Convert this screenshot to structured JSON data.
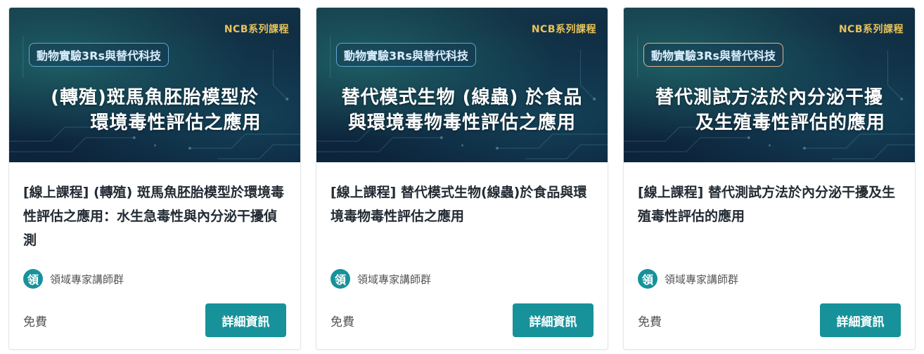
{
  "cards": [
    {
      "series": "NCB系列課程",
      "pill": "動物實驗3Rs與替代科技",
      "banner_line1": "(轉殖)斑馬魚胚胎模型於",
      "banner_line2": "環境毒性評估之應用",
      "title": "[線上課程] (轉殖) 斑馬魚胚胎模型於環境毒性評估之應用：水生急毒性與內分泌干擾偵測",
      "avatar_char": "領",
      "instructor": "領域專家講師群",
      "price": "免費",
      "button": "詳細資訊"
    },
    {
      "series": "NCB系列課程",
      "pill": "動物實驗3Rs與替代科技",
      "banner_line1": "替代模式生物 (線蟲) 於食品",
      "banner_line2": "與環境毒物毒性評估之應用",
      "title": "[線上課程] 替代模式生物(線蟲)於食品與環境毒物毒性評估之應用",
      "avatar_char": "領",
      "instructor": "領域專家講師群",
      "price": "免費",
      "button": "詳細資訊"
    },
    {
      "series": "NCB系列課程",
      "pill": "動物實驗3Rs與替代科技",
      "banner_line1": "替代測試方法於內分泌干擾",
      "banner_line2": "及生殖毒性評估的應用",
      "title": "[線上課程] 替代測試方法於內分泌干擾及生殖毒性評估的應用",
      "avatar_char": "領",
      "instructor": "領域專家講師群",
      "price": "免費",
      "button": "詳細資訊"
    }
  ],
  "colors": {
    "accent": "#17929a",
    "series_tag": "#e8c35a",
    "title_text": "#222a33"
  }
}
